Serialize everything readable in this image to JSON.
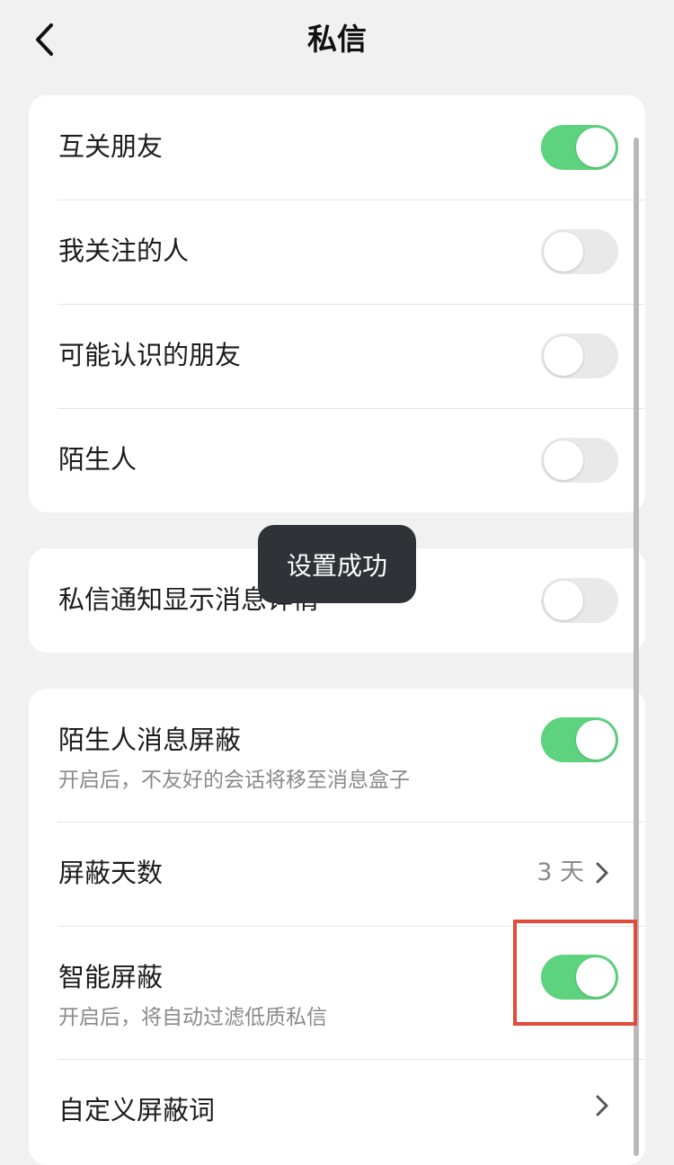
{
  "nav": {
    "title": "私信",
    "back_icon": "chevron-left-icon"
  },
  "group1": {
    "items": [
      {
        "label": "互关朋友",
        "on": true
      },
      {
        "label": "我关注的人",
        "on": false
      },
      {
        "label": "可能认识的朋友",
        "on": false
      },
      {
        "label": "陌生人",
        "on": false
      }
    ]
  },
  "group2": {
    "items": [
      {
        "label": "私信通知显示消息详情",
        "on": false
      }
    ]
  },
  "group3": {
    "stranger_block": {
      "label": "陌生人消息屏蔽",
      "sub": "开启后，不友好的会话将移至消息盒子",
      "on": true
    },
    "block_days": {
      "label": "屏蔽天数",
      "value": "3 天"
    },
    "smart_block": {
      "label": "智能屏蔽",
      "sub": "开启后，将自动过滤低质私信",
      "on": true
    },
    "custom_words": {
      "label": "自定义屏蔽词"
    }
  },
  "toast": {
    "text": "设置成功"
  },
  "colors": {
    "toggle_on": "#5ed37f",
    "toggle_off": "#e9e9ea",
    "highlight": "#e24a3a",
    "toast_bg": "#2f3237"
  }
}
